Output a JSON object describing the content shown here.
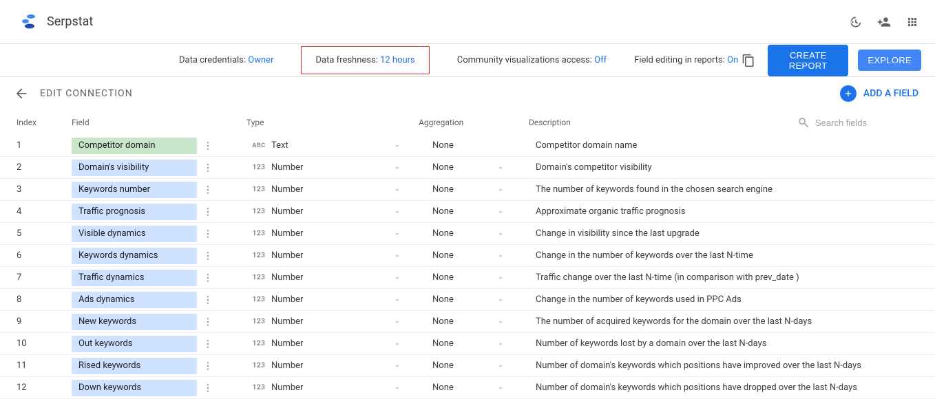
{
  "brand": "Serpstat",
  "settings": {
    "data_credentials_label": "Data credentials: ",
    "data_credentials_value": "Owner",
    "data_freshness_label": "Data freshness: ",
    "data_freshness_value": "12 hours",
    "community_viz_label": "Community visualizations access: ",
    "community_viz_value": "Off",
    "field_editing_label": "Field editing in reports: ",
    "field_editing_value": "On",
    "create_report": "Create Report",
    "explore": "Explore"
  },
  "editbar": {
    "title": "EDIT CONNECTION",
    "add_field": "ADD A FIELD"
  },
  "table": {
    "headers": {
      "index": "Index",
      "field": "Field",
      "type": "Type",
      "aggregation": "Aggregation",
      "description": "Description",
      "search_placeholder": "Search fields"
    },
    "rows": [
      {
        "index": "1",
        "field": "Competitor domain",
        "dim": true,
        "type_icon": "abc",
        "type": "Text",
        "agg": "None",
        "agg_dd": false,
        "desc": "Competitor domain name"
      },
      {
        "index": "2",
        "field": "Domain's visibility",
        "dim": false,
        "type_icon": "123",
        "type": "Number",
        "agg": "None",
        "agg_dd": true,
        "desc": "Domain's competitor visibility"
      },
      {
        "index": "3",
        "field": "Keywords number",
        "dim": false,
        "type_icon": "123",
        "type": "Number",
        "agg": "None",
        "agg_dd": true,
        "desc": "The number of keywords found in the chosen search engine"
      },
      {
        "index": "4",
        "field": "Traffic prognosis",
        "dim": false,
        "type_icon": "123",
        "type": "Number",
        "agg": "None",
        "agg_dd": true,
        "desc": "Approximate organic traffic prognosis"
      },
      {
        "index": "5",
        "field": "Visible dynamics",
        "dim": false,
        "type_icon": "123",
        "type": "Number",
        "agg": "None",
        "agg_dd": true,
        "desc": "Change in visibility since the last upgrade"
      },
      {
        "index": "6",
        "field": "Keywords dynamics",
        "dim": false,
        "type_icon": "123",
        "type": "Number",
        "agg": "None",
        "agg_dd": true,
        "desc": "Change in the number of keywords over the last N-time"
      },
      {
        "index": "7",
        "field": "Traffic dynamics",
        "dim": false,
        "type_icon": "123",
        "type": "Number",
        "agg": "None",
        "agg_dd": true,
        "desc": "Traffic change over the last N-time (in comparison with prev_date )"
      },
      {
        "index": "8",
        "field": "Ads dynamics",
        "dim": false,
        "type_icon": "123",
        "type": "Number",
        "agg": "None",
        "agg_dd": true,
        "desc": "Change in the number of keywords used in PPC Ads"
      },
      {
        "index": "9",
        "field": "New keywords",
        "dim": false,
        "type_icon": "123",
        "type": "Number",
        "agg": "None",
        "agg_dd": true,
        "desc": "The number of acquired keywords for the domain over the last N-days"
      },
      {
        "index": "10",
        "field": "Out keywords",
        "dim": false,
        "type_icon": "123",
        "type": "Number",
        "agg": "None",
        "agg_dd": true,
        "desc": "Number of keywords lost by a domain over the last N-days"
      },
      {
        "index": "11",
        "field": "Rised keywords",
        "dim": false,
        "type_icon": "123",
        "type": "Number",
        "agg": "None",
        "agg_dd": true,
        "desc": "Number of domain's keywords which positions have improved over the last N-days"
      },
      {
        "index": "12",
        "field": "Down keywords",
        "dim": false,
        "type_icon": "123",
        "type": "Number",
        "agg": "None",
        "agg_dd": true,
        "desc": "Number of domain's keywords which positions have dropped over the last N-days"
      }
    ]
  }
}
